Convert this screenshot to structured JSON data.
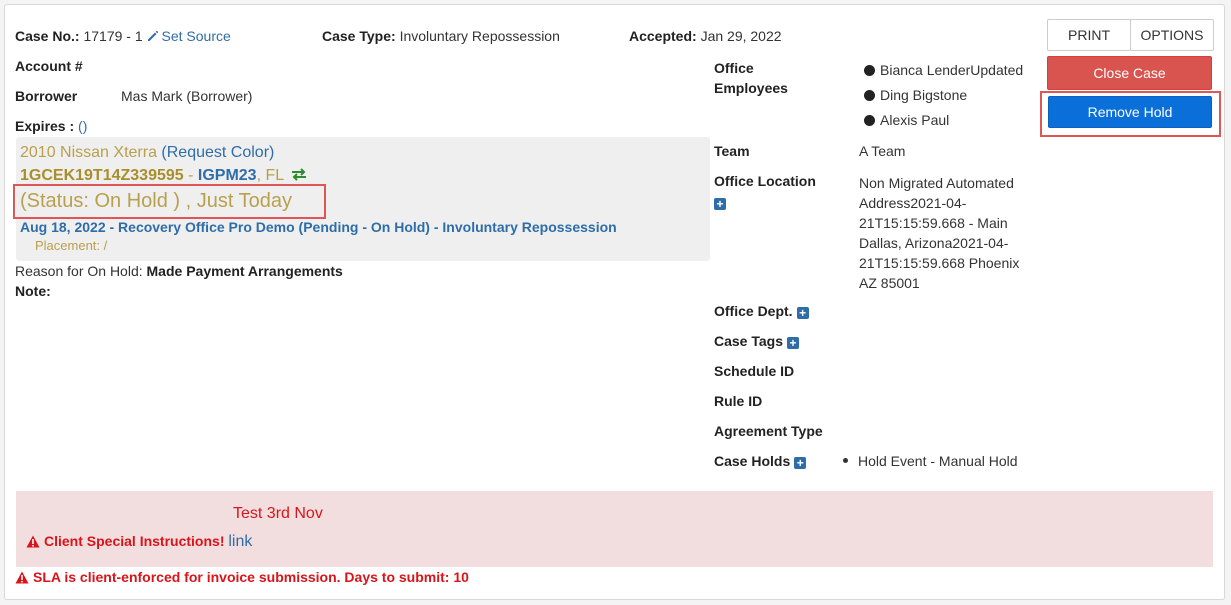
{
  "header": {
    "case_no_label": "Case No.:",
    "case_no_value": "17179 - 1",
    "set_source": "Set Source",
    "case_type_label": "Case Type:",
    "case_type_value": "Involuntary Repossession",
    "accepted_label": "Accepted:",
    "accepted_value": "Jan 29, 2022"
  },
  "toolbar": {
    "print": "PRINT",
    "options": "OPTIONS",
    "close_case": "Close Case",
    "remove_hold": "Remove Hold"
  },
  "left": {
    "account_label": "Account #",
    "borrower_label": "Borrower",
    "borrower_value": "Mas Mark (Borrower)",
    "expires_label": "Expires :",
    "expires_value": "()"
  },
  "vehicle": {
    "title": "2010 Nissan Xterra",
    "request_color": "(Request Color)",
    "vin": "1GCEK19T14Z339595",
    "sep": " - ",
    "plate": "IGPM23",
    "state": ", FL",
    "status": "(Status: On Hold ) , Just Today",
    "case_line": "Aug 18, 2022 - Recovery Office Pro Demo (Pending - On Hold) - Involuntary Repossession",
    "placement": "Placement: /"
  },
  "hold": {
    "reason_label": "Reason for On Hold:",
    "reason_value": "Made Payment Arrangements",
    "note_label": "Note:"
  },
  "office": {
    "employees_label_1": "Office",
    "employees_label_2": "Employees",
    "employees": [
      "Bianca LenderUpdated",
      "Ding Bigstone",
      "Alexis Paul"
    ],
    "team_label": "Team",
    "team_value": "A Team",
    "location_label": "Office Location",
    "location_lines": [
      "Non Migrated Automated",
      "Address2021-04-",
      "21T15:15:59.668 - Main",
      "Dallas, Arizona2021-04-",
      "21T15:15:59.668 Phoenix",
      "AZ 85001"
    ],
    "dept_label": "Office Dept.",
    "tags_label": "Case Tags",
    "schedule_label": "Schedule ID",
    "rule_label": "Rule ID",
    "agreement_label": "Agreement Type",
    "holds_label": "Case Holds",
    "holds_item": "Hold Event - Manual Hold"
  },
  "alerts": {
    "note": "Test 3rd Nov",
    "client_instructions": "Client Special Instructions!",
    "link": "link",
    "sla": "SLA is client-enforced for invoice submission. Days to submit: 10"
  },
  "colors": {
    "accent_blue": "#0a6fd8",
    "danger_red": "#d9534f",
    "highlight_box": "#e05555",
    "gold": "#b9a04e",
    "alert_bg": "#f2dede"
  }
}
